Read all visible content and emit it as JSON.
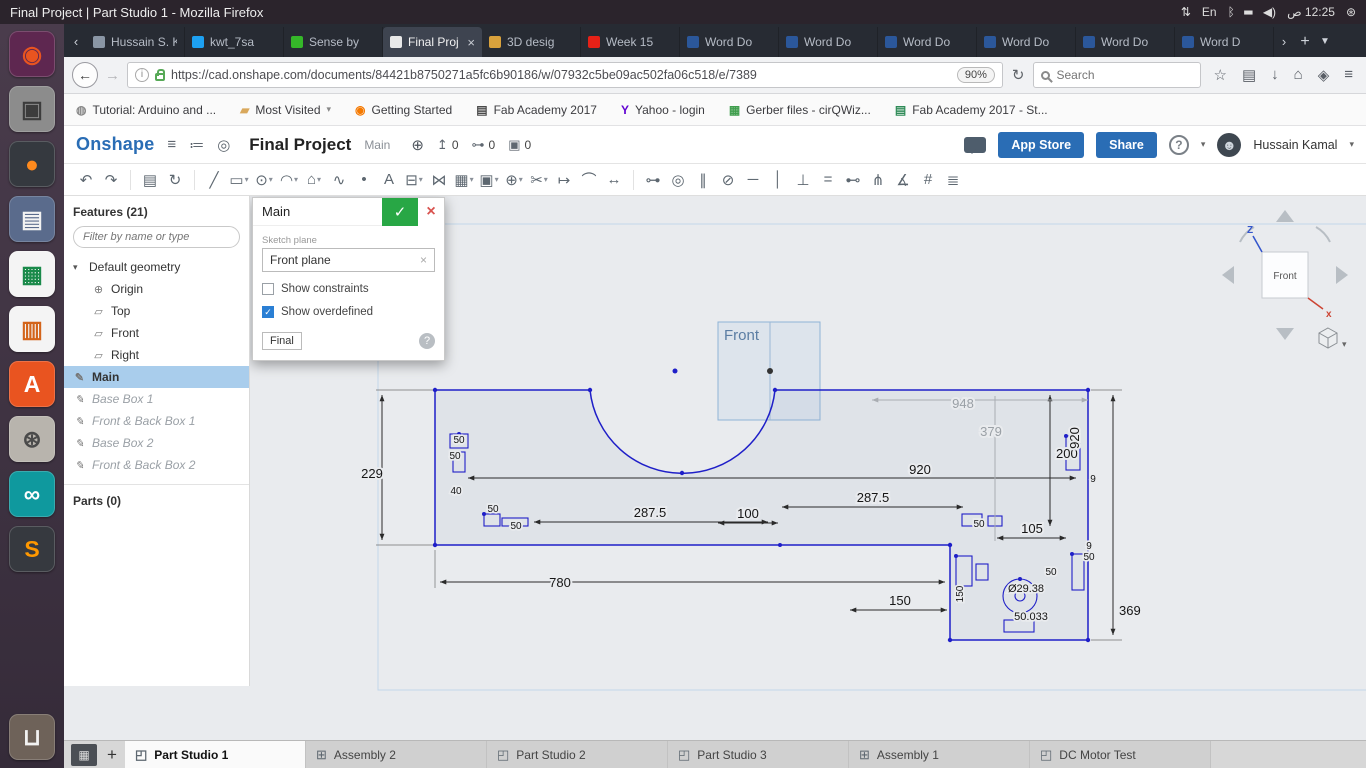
{
  "colors": {
    "accent_blue": "#2a6db5",
    "commit_green": "#28a745",
    "cancel_red": "#d9534f",
    "selected_feature": "#a9cdec",
    "sketch_blue": "#1f1fc8",
    "plane_blue": "#8fb3d6"
  },
  "system": {
    "window_title": "Final Project | Part Studio 1 - Mozilla Firefox",
    "keyboard_layout": "En",
    "clock": "ص 12:25",
    "tray": [
      {
        "name": "network",
        "glyph": "⇅"
      },
      {
        "name": "bluetooth",
        "glyph": "ᛒ"
      },
      {
        "name": "battery",
        "glyph": "▮"
      },
      {
        "name": "volume",
        "glyph": "◀)"
      },
      {
        "name": "session",
        "glyph": "⊛"
      }
    ],
    "launcher": [
      {
        "name": "ubuntu-dash",
        "glyph": "◉",
        "bg": "#5e2750",
        "fg": "#e95420"
      },
      {
        "name": "files",
        "glyph": "▣",
        "bg": "#8c8c8c",
        "fg": "#3c3c3c"
      },
      {
        "name": "firefox",
        "glyph": "●",
        "bg": "#35393f",
        "fg": "#ff8a1d"
      },
      {
        "name": "gedit",
        "glyph": "▤",
        "bg": "#5a6b8c",
        "fg": "#f2f2f2"
      },
      {
        "name": "libreoffice-calc",
        "glyph": "▦",
        "bg": "#f4f4f4",
        "fg": "#1a8a4a"
      },
      {
        "name": "libreoffice-impress",
        "glyph": "▥",
        "bg": "#f4f4f4",
        "fg": "#d3641a"
      },
      {
        "name": "software-center",
        "glyph": "A",
        "bg": "#e95420",
        "fg": "#ffffff"
      },
      {
        "name": "system-settings",
        "glyph": "⊛",
        "bg": "#b8b4ad",
        "fg": "#4a4a4a"
      },
      {
        "name": "arduino",
        "glyph": "∞",
        "bg": "#0f999e",
        "fg": "#ffffff"
      },
      {
        "name": "sublime-text",
        "glyph": "S",
        "bg": "#36393f",
        "fg": "#ff9800"
      },
      {
        "name": "trash",
        "glyph": "⊔",
        "bg": "#6e6259",
        "fg": "#f2f2f2"
      }
    ]
  },
  "browser": {
    "tab_scroll_left": "‹",
    "tab_scroll_right": "›",
    "new_tab": "+",
    "tab_list_caret": "▼",
    "tabs": [
      {
        "title": "Hussain S. K",
        "color": "#8a96a5"
      },
      {
        "title": "kwt_7sa",
        "color": "#1da1f2"
      },
      {
        "title": "Sense by",
        "color": "#35b729"
      },
      {
        "title": "Final Proj",
        "color": "#e8e8e8",
        "close": "×"
      },
      {
        "title": "3D desig",
        "color": "#d9a23c"
      },
      {
        "title": "Week 15",
        "color": "#e62117"
      },
      {
        "title": "Word Do",
        "color": "#2b579a"
      },
      {
        "title": "Word Do",
        "color": "#2b579a"
      },
      {
        "title": "Word Do",
        "color": "#2b579a"
      },
      {
        "title": "Word Do",
        "color": "#2b579a"
      },
      {
        "title": "Word Do",
        "color": "#2b579a"
      },
      {
        "title": "Word D",
        "color": "#2b579a"
      }
    ],
    "nav": {
      "back": "←",
      "forward": "→",
      "reload": "↻",
      "info": "i",
      "url": "https://cad.onshape.com/documents/84421b8750271a5fc6b90186/w/07932c5be09ac502fa06c518/e/7389",
      "zoom_badge": "90%",
      "search_placeholder": "Search",
      "actions": [
        {
          "name": "star",
          "glyph": "☆"
        },
        {
          "name": "bookmarks",
          "glyph": "▤"
        },
        {
          "name": "downloads",
          "glyph": "↓"
        },
        {
          "name": "home",
          "glyph": "⌂"
        },
        {
          "name": "pocket",
          "glyph": "◈"
        },
        {
          "name": "menu",
          "glyph": "≡"
        }
      ]
    },
    "bookmarks": [
      {
        "label": "Tutorial: Arduino and ...",
        "glyph": "◍",
        "color": "#8a8a8a"
      },
      {
        "label": "Most Visited",
        "glyph": "▰",
        "color": "#d9a85c",
        "caret": "▾"
      },
      {
        "label": "Getting Started",
        "glyph": "◉",
        "color": "#f57900"
      },
      {
        "label": "Fab Academy 2017",
        "glyph": "▤",
        "color": "#4a4a4a"
      },
      {
        "label": "Yahoo - login",
        "glyph": "Y",
        "color": "#5f01d1"
      },
      {
        "label": "Gerber files - cirQWiz...",
        "glyph": "▦",
        "color": "#3f9e4d"
      },
      {
        "label": "Fab Academy 2017 - St...",
        "glyph": "▤",
        "color": "#2e8b57"
      }
    ]
  },
  "onshape": {
    "logo": "Onshape",
    "doc_title": "Final Project",
    "workspace": "Main",
    "header_icons": [
      {
        "name": "main-menu",
        "glyph": "≡"
      },
      {
        "name": "versions",
        "glyph": "≔"
      },
      {
        "name": "history",
        "glyph": "◎"
      }
    ],
    "globe": "⊕",
    "stats": [
      {
        "name": "likes",
        "glyph": "↥",
        "value": "0"
      },
      {
        "name": "links",
        "glyph": "⊶",
        "value": "0"
      },
      {
        "name": "copies",
        "glyph": "▣",
        "value": "0"
      }
    ],
    "appstore_label": "App Store",
    "share_label": "Share",
    "help": "?",
    "caret": "▾",
    "user_name": "Hussain Kamal",
    "user_glyph": "☻",
    "toolbar": [
      {
        "name": "undo",
        "glyph": "↶"
      },
      {
        "name": "redo",
        "glyph": "↷"
      },
      {
        "name": "sketch",
        "glyph": "▤"
      },
      {
        "name": "update",
        "glyph": "↻"
      },
      {
        "name": "line",
        "glyph": "╱"
      },
      {
        "name": "rectangle",
        "glyph": "▭",
        "caret": "▾"
      },
      {
        "name": "circle",
        "glyph": "⊙",
        "caret": "▾"
      },
      {
        "name": "arc",
        "glyph": "◠",
        "caret": "▾"
      },
      {
        "name": "polygon",
        "glyph": "⌂",
        "caret": "▾"
      },
      {
        "name": "spline",
        "glyph": "∿"
      },
      {
        "name": "point",
        "glyph": "•"
      },
      {
        "name": "text",
        "glyph": "A"
      },
      {
        "name": "slot",
        "glyph": "⊟",
        "caret": "▾"
      },
      {
        "name": "mirror",
        "glyph": "⋈"
      },
      {
        "name": "pattern",
        "glyph": "▦",
        "caret": "▾"
      },
      {
        "name": "offset",
        "glyph": "▣",
        "caret": "▾"
      },
      {
        "name": "transform",
        "glyph": "⊕",
        "caret": "▾"
      },
      {
        "name": "trim",
        "glyph": "✂",
        "caret": "▾"
      },
      {
        "name": "extend",
        "glyph": "↦"
      },
      {
        "name": "fillet",
        "glyph": "⌒"
      },
      {
        "name": "dimension",
        "glyph": "↔"
      },
      {
        "name": "coincident",
        "glyph": "⊶"
      },
      {
        "name": "concentric",
        "glyph": "◎"
      },
      {
        "name": "parallel",
        "glyph": "∥"
      },
      {
        "name": "tangent",
        "glyph": "⊘"
      },
      {
        "name": "horizontal",
        "glyph": "─"
      },
      {
        "name": "vertical",
        "glyph": "│"
      },
      {
        "name": "perpendicular",
        "glyph": "⊥"
      },
      {
        "name": "equal",
        "glyph": "="
      },
      {
        "name": "midpoint",
        "glyph": "⊷"
      },
      {
        "name": "normal",
        "glyph": "⋔"
      },
      {
        "name": "angle",
        "glyph": "∡"
      },
      {
        "name": "pierce",
        "glyph": "#"
      },
      {
        "name": "fix",
        "glyph": "≣"
      }
    ],
    "features": {
      "header": "Features (21)",
      "filter_placeholder": "Filter by name or type",
      "group_caret": "▾",
      "group": "Default geometry",
      "items": [
        {
          "label": "Origin",
          "glyph": "⊕"
        },
        {
          "label": "Top",
          "glyph": "▱"
        },
        {
          "label": "Front",
          "glyph": "▱"
        },
        {
          "label": "Right",
          "glyph": "▱"
        }
      ],
      "selected": {
        "label": "Main",
        "glyph": "✎"
      },
      "suppressed": [
        {
          "label": "Base Box 1",
          "glyph": "✎"
        },
        {
          "label": "Front & Back Box 1",
          "glyph": "✎"
        },
        {
          "label": "Base Box 2",
          "glyph": "✎"
        },
        {
          "label": "Front & Back Box 2",
          "glyph": "✎"
        }
      ],
      "parts_header": "Parts (0)"
    },
    "dialog": {
      "title": "Main",
      "accept": "✓",
      "close": "×",
      "plane_label": "Sketch plane",
      "plane_value": "Front plane",
      "plane_clear": "×",
      "checkbox_constraints": "Show constraints",
      "checkbox_overdefined": "Show overdefined",
      "final_label": "Final",
      "help": "?"
    },
    "sketch": {
      "plane_tag": "Front",
      "dims": {
        "d229": "229",
        "d780": "780",
        "d920": "920",
        "d2875a": "287.5",
        "d2875b": "287.5",
        "d100": "100",
        "d105": "105",
        "d150": "150",
        "d369": "369",
        "d200": "200",
        "d379": "379",
        "d948": "948",
        "d920v": "920",
        "d9a": "9",
        "d9b": "9",
        "d50a": "50",
        "d50b": "50",
        "d40": "40",
        "d50c": "50",
        "d50d": "50",
        "d50e": "50",
        "d50f": "50",
        "d50g": "50",
        "d150v": "150",
        "dia": "Ø29.38",
        "d50033": "50.033"
      }
    },
    "viewcube": {
      "face": "Front",
      "z": "Z",
      "x": "x",
      "caret": "▾"
    },
    "doc_tabs": {
      "manage_glyph": "▦",
      "add": "+",
      "tabs": [
        {
          "label": "Part Studio 1",
          "glyph": "◰"
        },
        {
          "label": "Assembly 2",
          "glyph": "⊞"
        },
        {
          "label": "Part Studio 2",
          "glyph": "◰"
        },
        {
          "label": "Part Studio 3",
          "glyph": "◰"
        },
        {
          "label": "Assembly 1",
          "glyph": "⊞"
        },
        {
          "label": "DC Motor Test",
          "glyph": "◰"
        }
      ]
    }
  }
}
